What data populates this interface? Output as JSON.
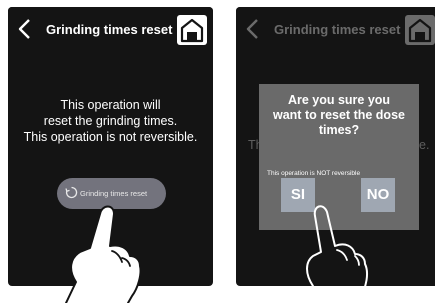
{
  "screen1": {
    "title": "Grinding times reset",
    "message": [
      "This operation will",
      "reset the grinding times.",
      "This operation is not reversible."
    ],
    "reset_button_label": "Grinding times reset"
  },
  "screen2": {
    "title": "Grinding times reset",
    "bg_left": "Th",
    "bg_right": "e.",
    "dialog": {
      "question": [
        "Are you sure you",
        "want to reset the dose",
        "times?"
      ],
      "note": "This operation is NOT reversible",
      "yes_label": "SI",
      "no_label": "NO"
    }
  },
  "icons": [
    "back-chevron-icon",
    "home-icon",
    "reset-icon",
    "pointing-hand-icon"
  ]
}
